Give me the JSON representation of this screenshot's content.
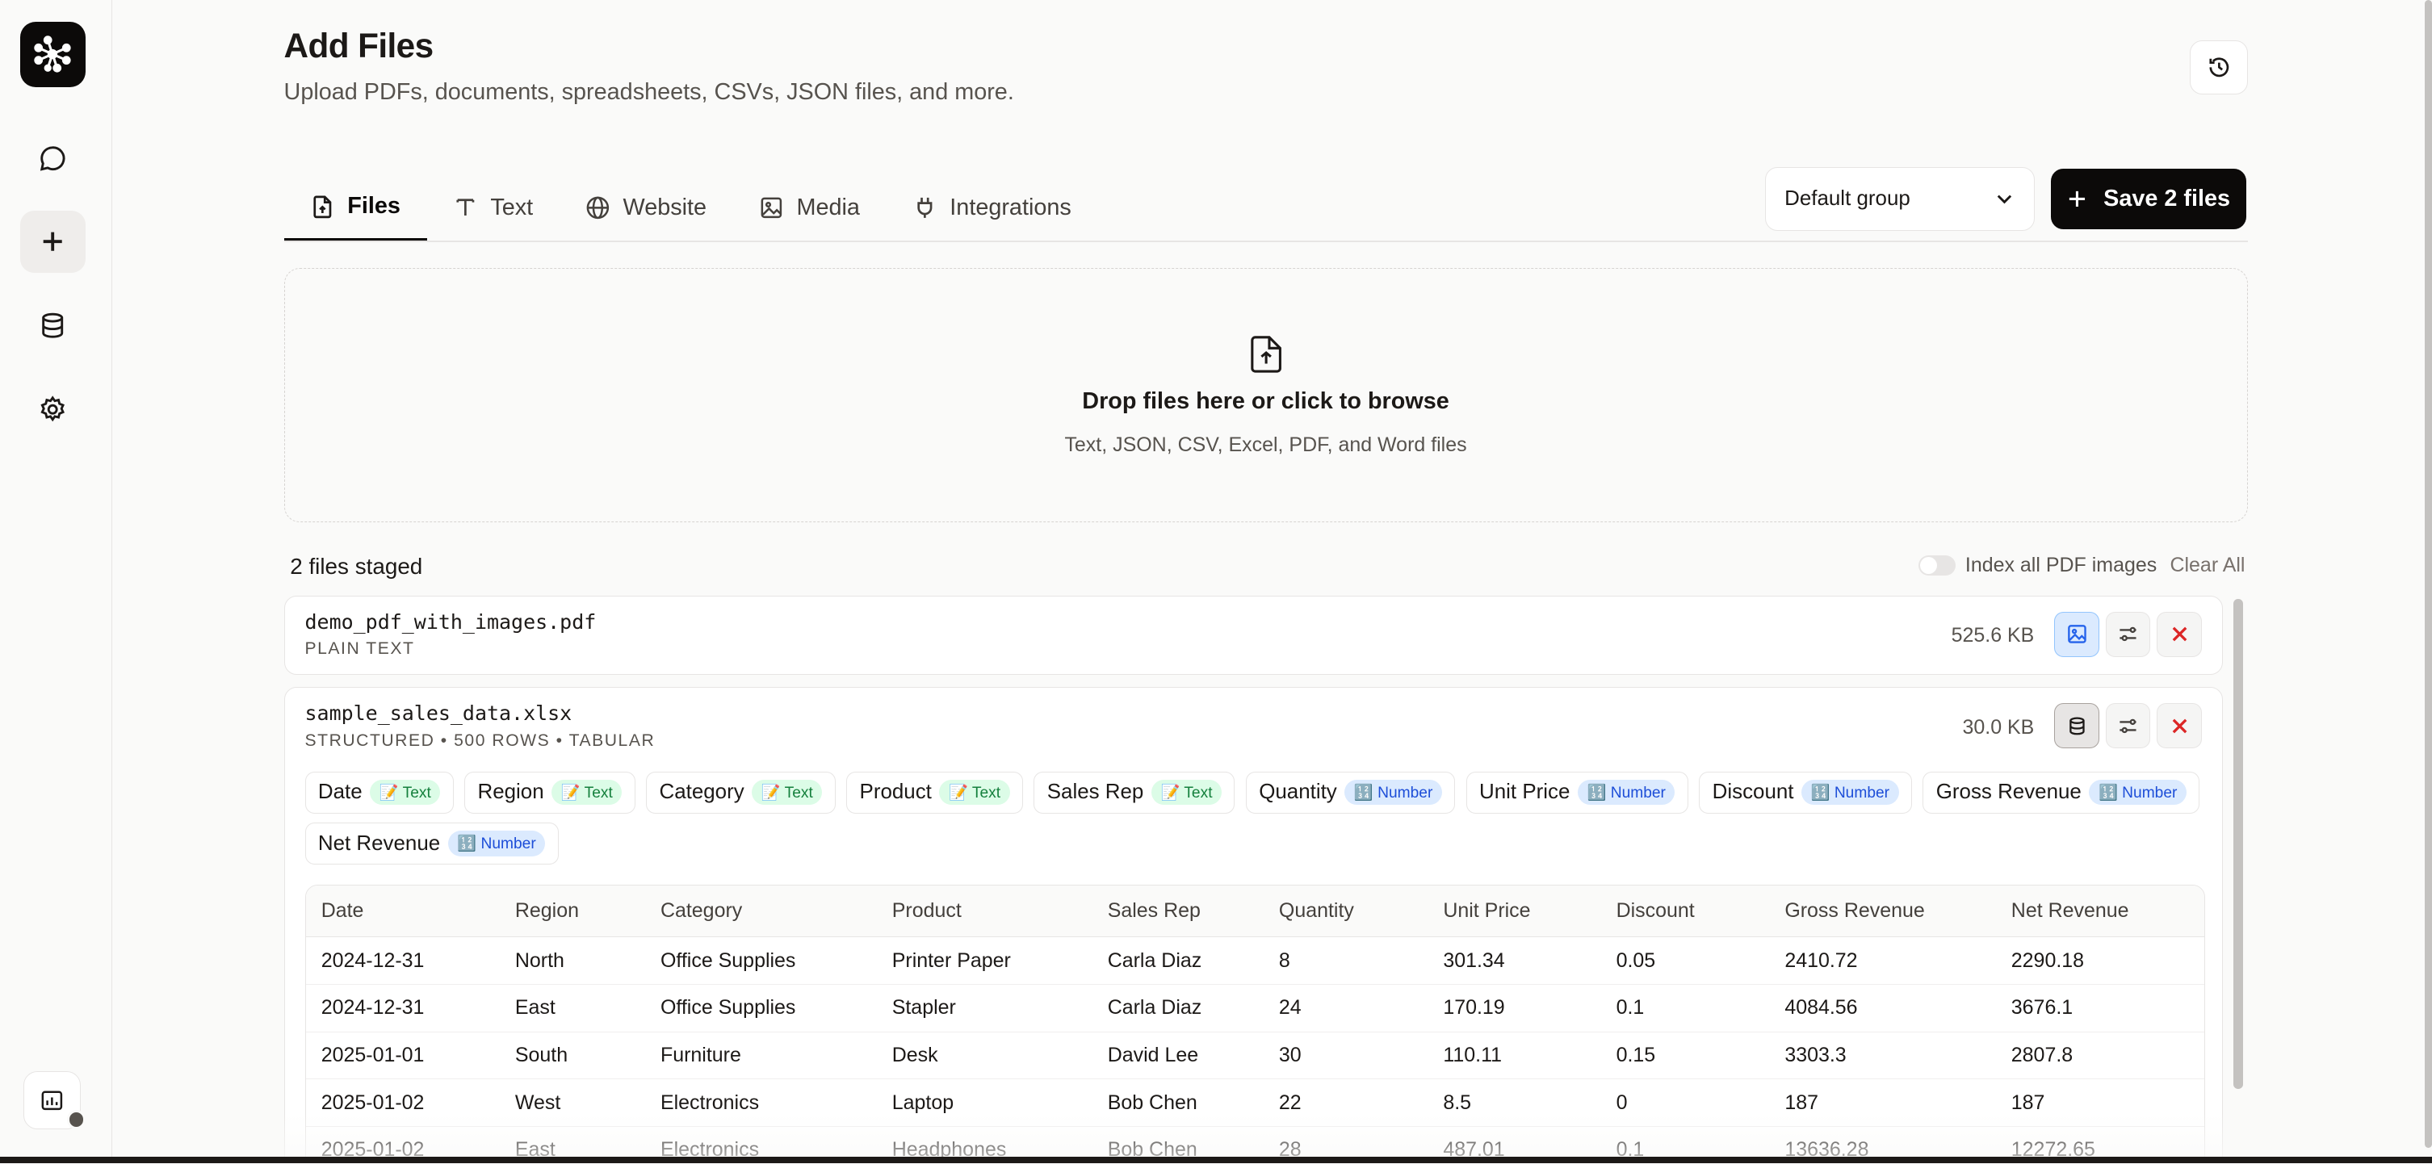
{
  "header": {
    "title": "Add Files",
    "subtitle": "Upload PDFs, documents, spreadsheets, CSVs, JSON files, and more."
  },
  "sidebar": {
    "items": [
      {
        "icon": "chat-icon"
      },
      {
        "icon": "plus-icon",
        "active": true
      },
      {
        "icon": "database-icon"
      },
      {
        "icon": "gear-icon"
      }
    ]
  },
  "tabs": [
    {
      "label": "Files",
      "icon": "file-upload-icon",
      "active": true
    },
    {
      "label": "Text",
      "icon": "text-icon"
    },
    {
      "label": "Website",
      "icon": "globe-icon"
    },
    {
      "label": "Media",
      "icon": "image-icon"
    },
    {
      "label": "Integrations",
      "icon": "plug-icon"
    }
  ],
  "group_select": {
    "value": "Default group"
  },
  "save_button": {
    "label": "Save 2 files"
  },
  "dropzone": {
    "title": "Drop files here or click to browse",
    "subtitle": "Text, JSON, CSV, Excel, PDF, and Word files"
  },
  "staged": {
    "title": "2 files staged",
    "toggle_label": "Index all PDF images",
    "toggle_on": false,
    "clear_label": "Clear All"
  },
  "files": [
    {
      "name": "demo_pdf_with_images.pdf",
      "meta": "PLAIN TEXT",
      "size": "525.6 KB"
    },
    {
      "name": "sample_sales_data.xlsx",
      "meta": "STRUCTURED • 500 ROWS • TABULAR",
      "size": "30.0 KB"
    }
  ],
  "columns": [
    {
      "name": "Date",
      "type": "📝 Text",
      "kind": "text"
    },
    {
      "name": "Region",
      "type": "📝 Text",
      "kind": "text"
    },
    {
      "name": "Category",
      "type": "📝 Text",
      "kind": "text"
    },
    {
      "name": "Product",
      "type": "📝 Text",
      "kind": "text"
    },
    {
      "name": "Sales Rep",
      "type": "📝 Text",
      "kind": "text"
    },
    {
      "name": "Quantity",
      "type": "🔢 Number",
      "kind": "number"
    },
    {
      "name": "Unit Price",
      "type": "🔢 Number",
      "kind": "number"
    },
    {
      "name": "Discount",
      "type": "🔢 Number",
      "kind": "number"
    },
    {
      "name": "Gross Revenue",
      "type": "🔢 Number",
      "kind": "number"
    },
    {
      "name": "Net Revenue",
      "type": "🔢 Number",
      "kind": "number"
    }
  ],
  "table": {
    "headers": [
      "Date",
      "Region",
      "Category",
      "Product",
      "Sales Rep",
      "Quantity",
      "Unit Price",
      "Discount",
      "Gross Revenue",
      "Net Revenue"
    ],
    "rows": [
      [
        "2024-12-31",
        "North",
        "Office Supplies",
        "Printer Paper",
        "Carla Diaz",
        "8",
        "301.34",
        "0.05",
        "2410.72",
        "2290.18"
      ],
      [
        "2024-12-31",
        "East",
        "Office Supplies",
        "Stapler",
        "Carla Diaz",
        "24",
        "170.19",
        "0.1",
        "4084.56",
        "3676.1"
      ],
      [
        "2025-01-01",
        "South",
        "Furniture",
        "Desk",
        "David Lee",
        "30",
        "110.11",
        "0.15",
        "3303.3",
        "2807.8"
      ],
      [
        "2025-01-02",
        "West",
        "Electronics",
        "Laptop",
        "Bob Chen",
        "22",
        "8.5",
        "0",
        "187",
        "187"
      ],
      [
        "2025-01-02",
        "East",
        "Electronics",
        "Headphones",
        "Bob Chen",
        "28",
        "487.01",
        "0.1",
        "13636.28",
        "12272.65"
      ]
    ]
  }
}
